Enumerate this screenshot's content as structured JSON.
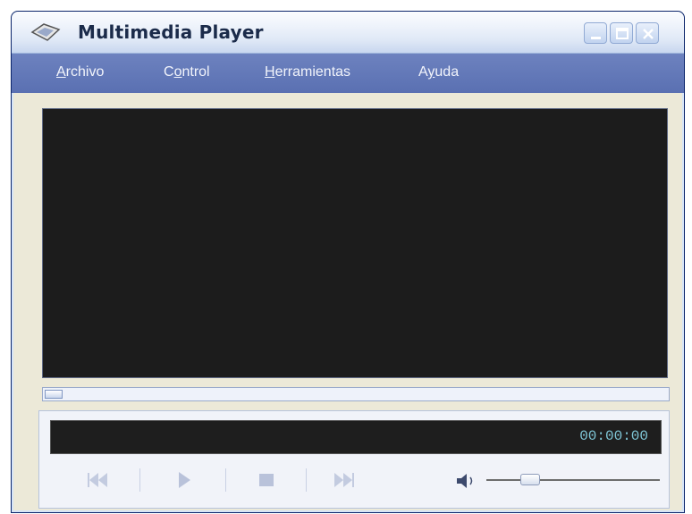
{
  "window": {
    "title": "Multimedia Player"
  },
  "menu": [
    {
      "label": "Archivo",
      "accel": "A",
      "rest": "rchivo"
    },
    {
      "label": "Control",
      "accel": "o",
      "pre": "C",
      "rest": "ntrol"
    },
    {
      "label": "Herramientas",
      "accel": "H",
      "rest": "erramientas"
    },
    {
      "label": "Ayuda",
      "accel": "y",
      "pre": "A",
      "rest": "uda"
    }
  ],
  "playback": {
    "time": "00:00:00",
    "seek_position": 0,
    "volume": 0.22
  },
  "icons": {
    "app": "media-player-icon",
    "minimize": "minimize-icon",
    "maximize": "maximize-icon",
    "close": "close-icon",
    "rewind": "rewind-icon",
    "play": "play-icon",
    "stop": "stop-icon",
    "fast_forward": "fast-forward-icon",
    "volume": "speaker-icon"
  },
  "colors": {
    "menubar": "#5a70b2",
    "video": "#1c1c1c",
    "time_text": "#7fc6d6"
  }
}
